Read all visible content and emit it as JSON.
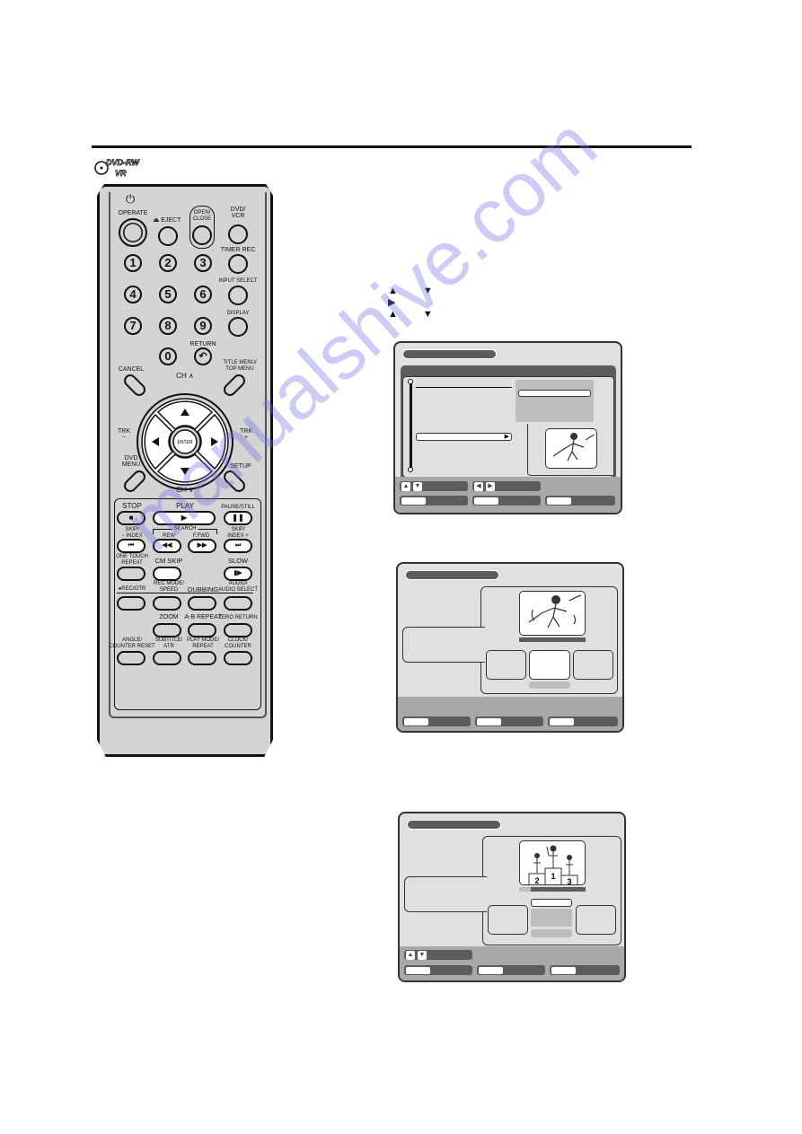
{
  "page": {
    "disc_badge": {
      "line1": "DVD-RW",
      "line2": "VR"
    }
  },
  "remote": {
    "top_row": [
      {
        "label": "OPERATE",
        "icon": "power-icon"
      },
      {
        "label": "EJECT",
        "icon": "eject-icon"
      },
      {
        "label": "OPEN/\nCLOSE"
      },
      {
        "label": "DVD/\nVCR"
      }
    ],
    "numbers": [
      "1",
      "2",
      "3",
      "4",
      "5",
      "6",
      "7",
      "8",
      "9",
      "0"
    ],
    "side_labels": {
      "timer_rec": "TIMER REC",
      "input_select": "INPUT SELECT",
      "display": "DISPLAY",
      "return": "RETURN"
    },
    "nav": {
      "cancel": "CANCEL",
      "title_menu": "TITLE MENU/\nTOP MENU",
      "ch_up": "CH ∧",
      "ch_down": "CH ∨",
      "trk_minus": "TRK\n−",
      "trk_plus": "TRK\n+",
      "enter": "ENTER",
      "dvd_menu": "DVD\nMENU",
      "setup": "SETUP"
    },
    "transport": {
      "stop": "STOP",
      "play": "PLAY",
      "pause": "PAUSE/STILL",
      "skip_minus": "SKIP/\n− INDEX",
      "search": "SEARCH",
      "rew": "REW",
      "fwd": "F.FWD",
      "skip_plus": "SKIP/\nINDEX +",
      "one_touch_repeat": "ONE TOUCH\nREPEAT",
      "cm_skip": "CM SKIP",
      "slow": "SLOW",
      "rec_otr": "●REC/OTR",
      "rec_mode": "REC MODE/\nSPEED",
      "dubbing": "DUBBING",
      "audio": "AUDIO/\nAUDIO SELECT",
      "zoom": "ZOOM",
      "ab_repeat": "A-B REPEAT",
      "zero_return": "ZERO RETURN",
      "angle": "ANGLE/\nCOUNTER RESET",
      "subtitle": "SUBTITLE/\nATR",
      "play_mode": "PLAY MODE/\nREPEAT",
      "clock": "CLOCK/\nCOUNTER"
    }
  },
  "instructions": {
    "step_arrows": [
      {
        "first": "▲",
        "second": "▼"
      },
      {
        "first": "▶"
      },
      {
        "first": "▲",
        "second": "▼"
      }
    ]
  },
  "osd_screens": {
    "screen1": {
      "footer_nav1": [
        "▲",
        "▼"
      ],
      "footer_nav2": [
        "◀",
        "▶"
      ],
      "list_item_arrow": "▶"
    },
    "screen2": {},
    "screen3": {
      "footer_nav1": [
        "▲",
        "▼"
      ],
      "podium_numbers": [
        "2",
        "1",
        "3"
      ],
      "progress": 0.18
    }
  },
  "watermark": "manualshive.com"
}
